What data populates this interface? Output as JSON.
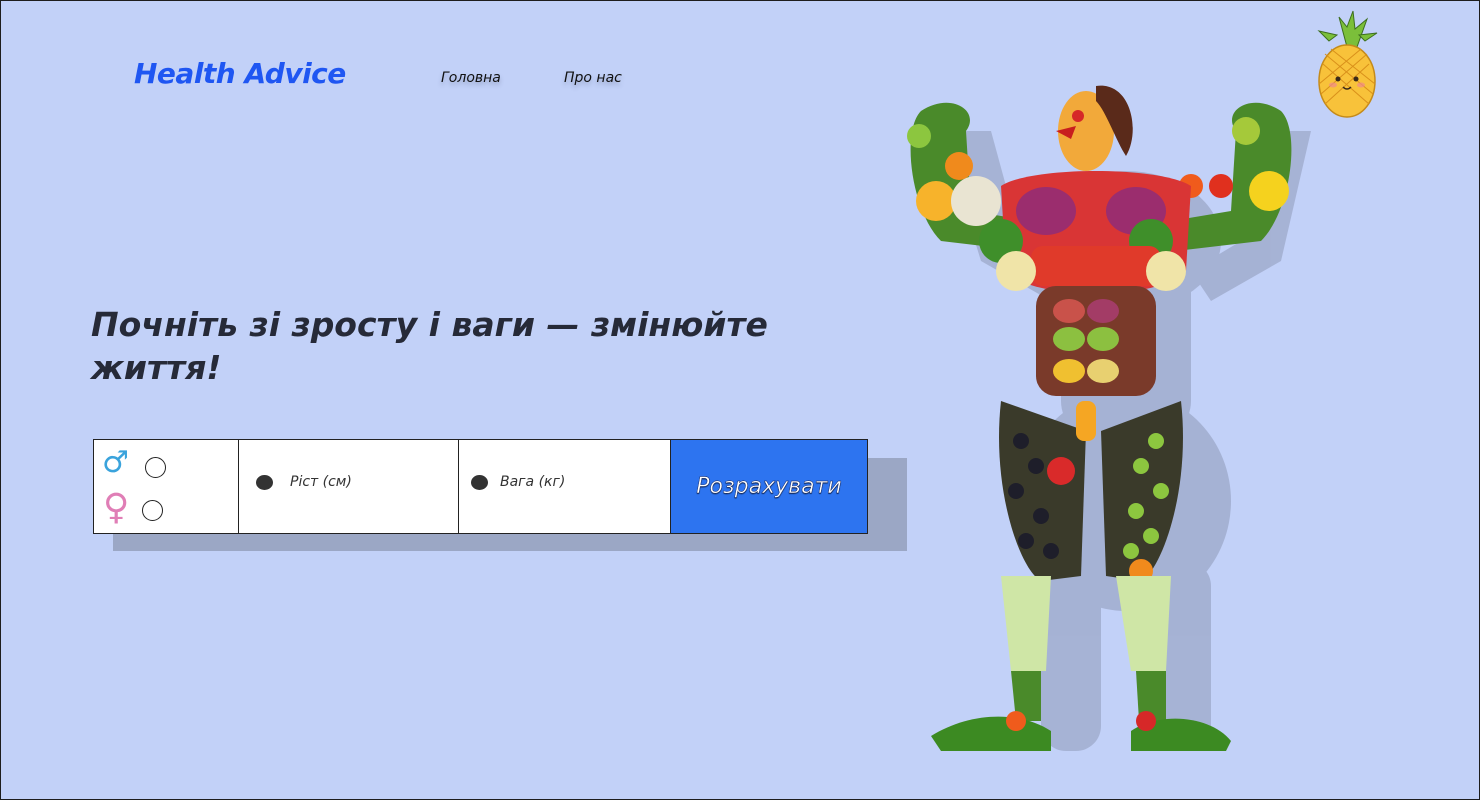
{
  "header": {
    "logo": "Health Advice",
    "nav": [
      {
        "label": "Головна"
      },
      {
        "label": "Про нас"
      }
    ]
  },
  "hero": {
    "headline": "Почніть зі зросту і ваги — змінюйте життя!"
  },
  "form": {
    "gender_options": [
      {
        "icon": "male-symbol-icon",
        "selected": false
      },
      {
        "icon": "female-symbol-icon",
        "selected": false
      }
    ],
    "height_placeholder": "Ріст (см)",
    "weight_placeholder": "Вага (кг)",
    "submit_label": "Розрахувати"
  },
  "colors": {
    "background": "#c2d1f8",
    "brand": "#1f56f2",
    "button": "#2d74f0"
  }
}
